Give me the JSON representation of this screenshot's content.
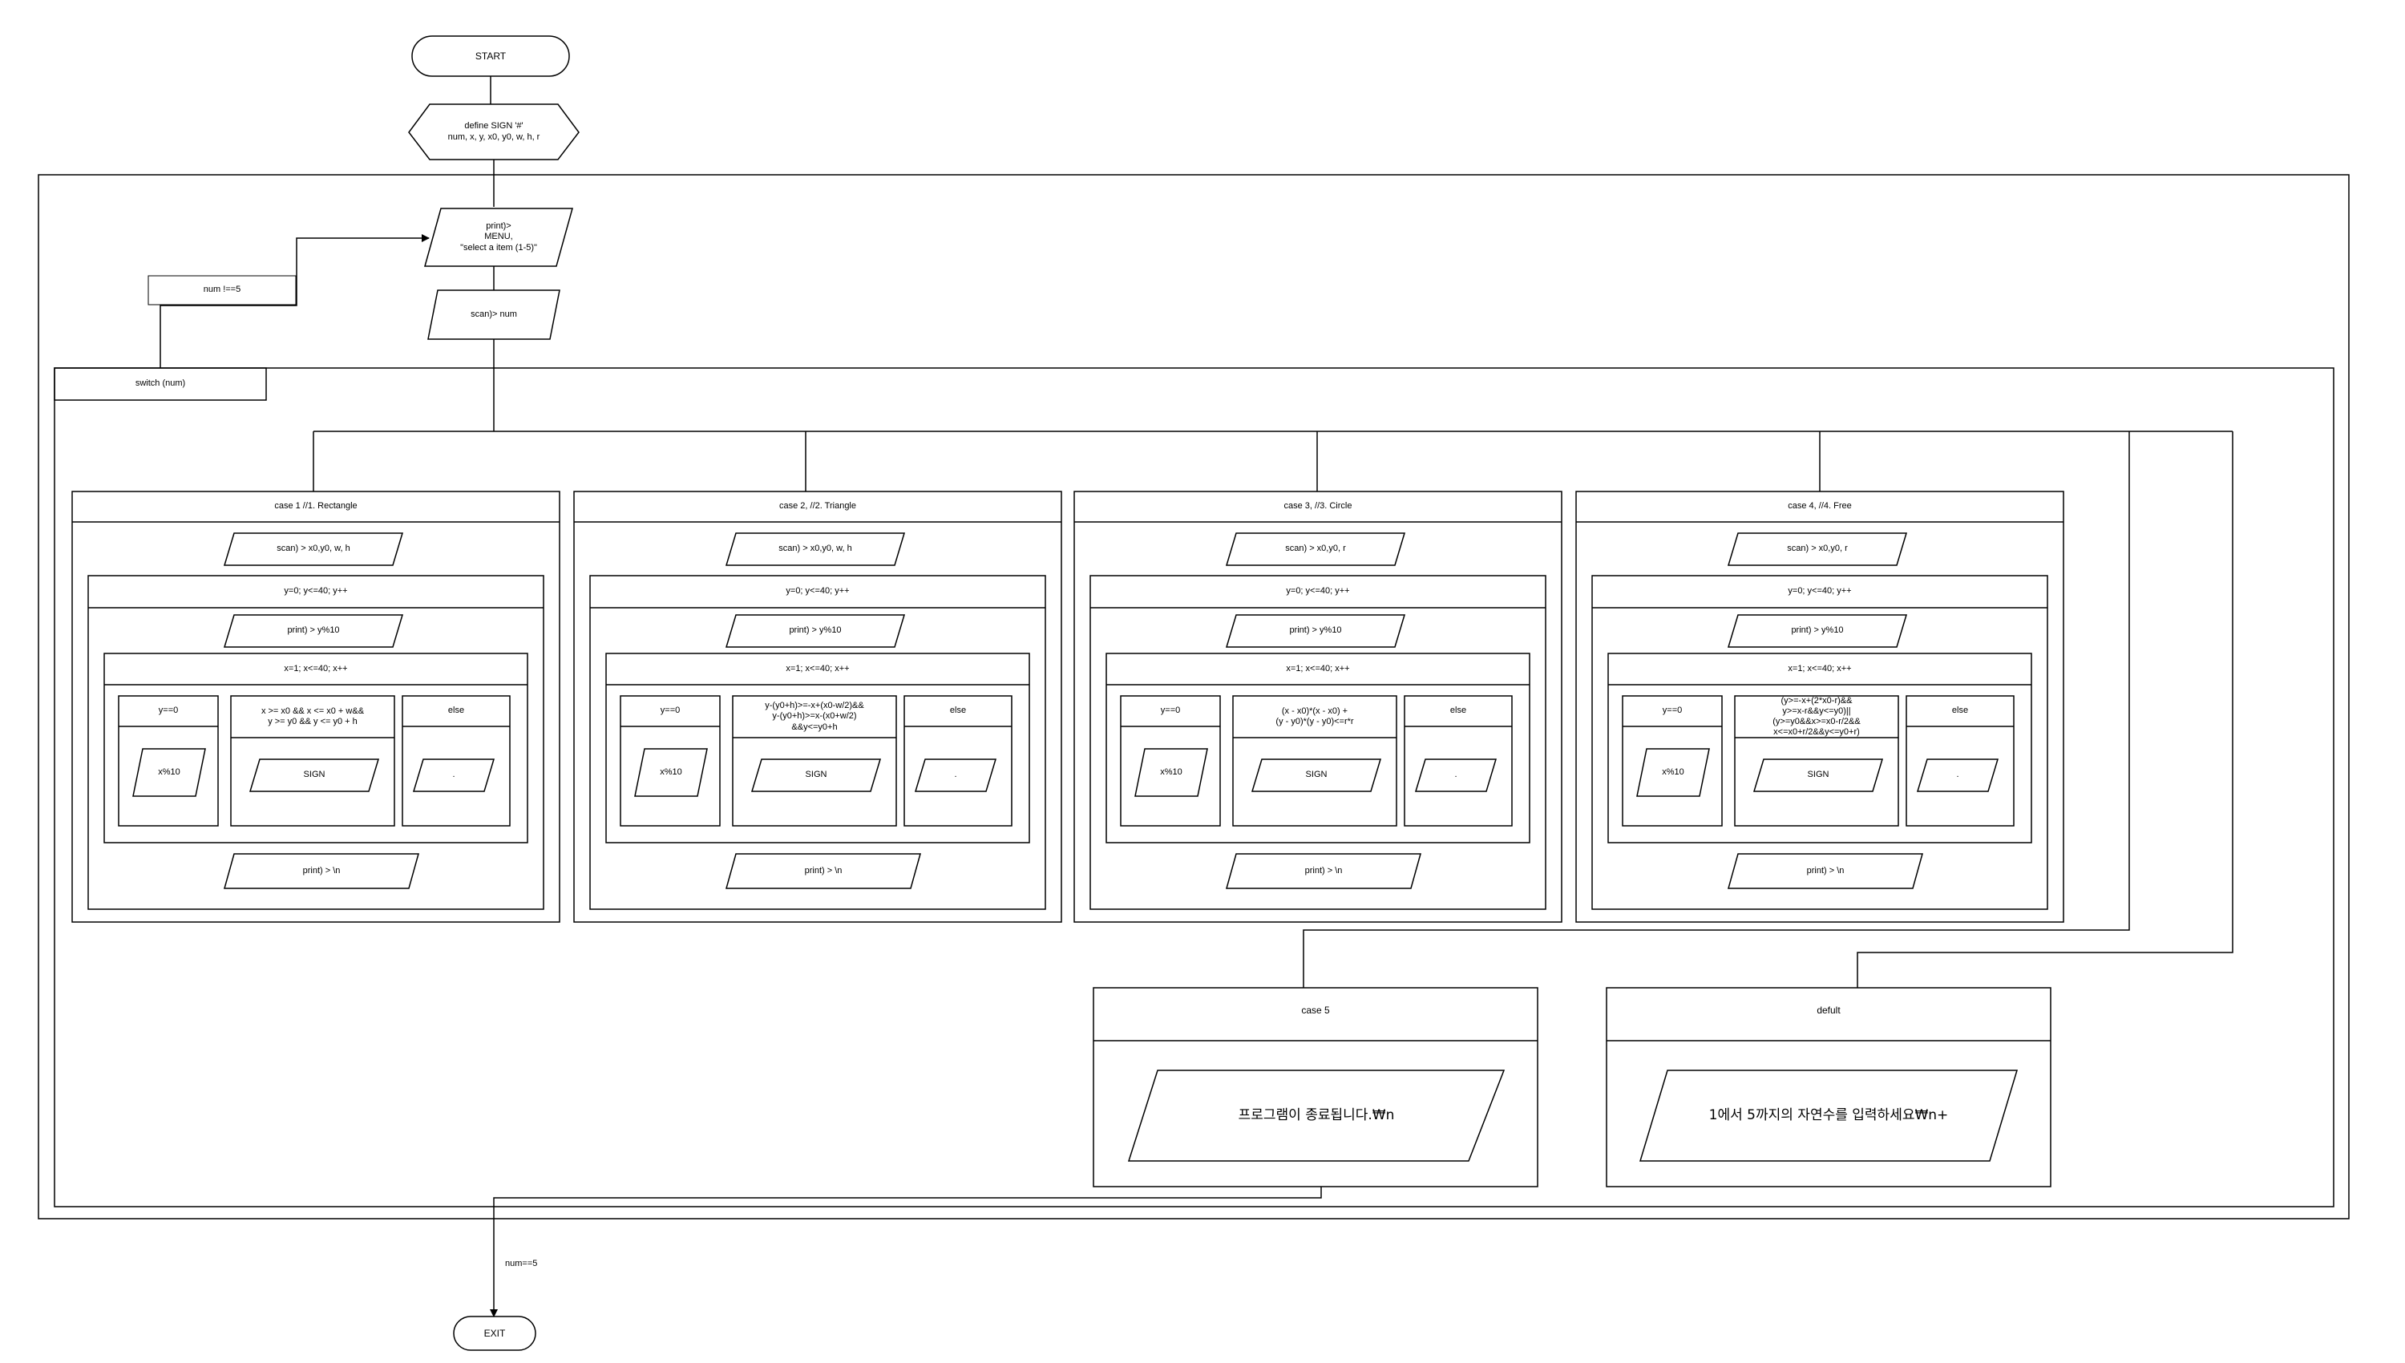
{
  "flow": {
    "start": "START",
    "define": "define SIGN '#'\nnum, x, y, x0, y0, w, h, r",
    "print_menu": "print)>\nMENU,\n\"select a item (1-5)\"",
    "scan_num": "scan)> num",
    "loop_cond": "num !==5",
    "switch": "switch (num)",
    "exit_cond": "num==5",
    "exit": "EXIT"
  },
  "cases": [
    {
      "header": "case 1   //1. Rectangle",
      "scan": "scan) > x0,y0, w, h",
      "outer_loop": "y=0; y<=40; y++",
      "print_y": "print) > y%10",
      "inner_loop": "x=1; x<=40; x++",
      "branch_a": "y==0",
      "branch_a_action": "x%10",
      "branch_b": "x >= x0 && x <= x0 + w&&\ny >= y0 && y <= y0 + h",
      "branch_b_action": "SIGN",
      "branch_c": "else",
      "branch_c_action": ".",
      "print_newline": "print) > \\n"
    },
    {
      "header": "case 2, //2. Triangle",
      "scan": "scan) > x0,y0, w, h",
      "outer_loop": "y=0; y<=40; y++",
      "print_y": "print) > y%10",
      "inner_loop": "x=1; x<=40; x++",
      "branch_a": "y==0",
      "branch_a_action": "x%10",
      "branch_b": "y-(y0+h)>=-x+(x0-w/2)&&\ny-(y0+h)>=x-(x0+w/2)\n&&y<=y0+h",
      "branch_b_action": "SIGN",
      "branch_c": "else",
      "branch_c_action": ".",
      "print_newline": "print) > \\n"
    },
    {
      "header": "case  3, //3. Circle",
      "scan": "scan) > x0,y0, r",
      "outer_loop": "y=0; y<=40; y++",
      "print_y": "print) > y%10",
      "inner_loop": "x=1; x<=40; x++",
      "branch_a": "y==0",
      "branch_a_action": "x%10",
      "branch_b": "(x - x0)*(x - x0) +\n(y - y0)*(y - y0)<=r*r",
      "branch_b_action": "SIGN",
      "branch_c": "else",
      "branch_c_action": ".",
      "print_newline": "print) > \\n"
    },
    {
      "header": "case 4, //4. Free",
      "scan": "scan) > x0,y0, r",
      "outer_loop": "y=0; y<=40; y++",
      "print_y": "print) > y%10",
      "inner_loop": "x=1; x<=40; x++",
      "branch_a": "y==0",
      "branch_a_action": "x%10",
      "branch_b": "(y>=-x+(2*x0-r)&&\ny>=x-r&&y<=y0)||\n(y>=y0&&x>=x0-r/2&&\nx<=x0+r/2&&y<=y0+r)",
      "branch_b_action": "SIGN",
      "branch_c": "else",
      "branch_c_action": ".",
      "print_newline": "print) > \\n"
    }
  ],
  "case5": {
    "header": "case 5",
    "action": "프로그램이 종료됩니다.₩n"
  },
  "default_case": {
    "header": "defult",
    "action": "1에서 5까지의 자연수를 입력하세요₩n+"
  }
}
